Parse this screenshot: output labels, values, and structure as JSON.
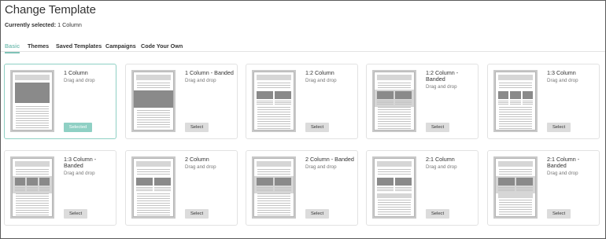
{
  "header": {
    "title": "Change Template",
    "current_label": "Currently selected:",
    "current_value": "1 Column"
  },
  "tabs": [
    {
      "label": "Basic",
      "active": true
    },
    {
      "label": "Themes",
      "active": false
    },
    {
      "label": "Saved Templates",
      "active": false
    },
    {
      "label": "Campaigns",
      "active": false
    },
    {
      "label": "Code Your Own",
      "active": false
    }
  ],
  "templates": [
    {
      "name": "1 Column",
      "desc": "Drag and drop",
      "button": "Selected",
      "selected": true,
      "layout": "1col"
    },
    {
      "name": "1 Column - Banded",
      "desc": "Drag and drop",
      "button": "Select",
      "selected": false,
      "layout": "1col-banded"
    },
    {
      "name": "1:2 Column",
      "desc": "Drag and drop",
      "button": "Select",
      "selected": false,
      "layout": "1-2col"
    },
    {
      "name": "1:2 Column - Banded",
      "desc": "Drag and drop",
      "button": "Select",
      "selected": false,
      "layout": "1-2col-banded"
    },
    {
      "name": "1:3 Column",
      "desc": "Drag and drop",
      "button": "Select",
      "selected": false,
      "layout": "1-3col"
    },
    {
      "name": "1:3 Column - Banded",
      "desc": "Drag and drop",
      "button": "Select",
      "selected": false,
      "layout": "1-3col-banded"
    },
    {
      "name": "2 Column",
      "desc": "Drag and drop",
      "button": "Select",
      "selected": false,
      "layout": "2col"
    },
    {
      "name": "2 Column - Banded",
      "desc": "Drag and drop",
      "button": "Select",
      "selected": false,
      "layout": "2col-banded"
    },
    {
      "name": "2:1 Column",
      "desc": "Drag and drop",
      "button": "Select",
      "selected": false,
      "layout": "2-1col"
    },
    {
      "name": "2:1 Column - Banded",
      "desc": "Drag and drop",
      "button": "Select",
      "selected": false,
      "layout": "2-1col-banded"
    }
  ],
  "colors": {
    "accent": "#7fc2b7",
    "selected_button": "#8fd0c4",
    "select_button": "#dcdcdc",
    "thumbnail_block": "#8a8a8a"
  }
}
